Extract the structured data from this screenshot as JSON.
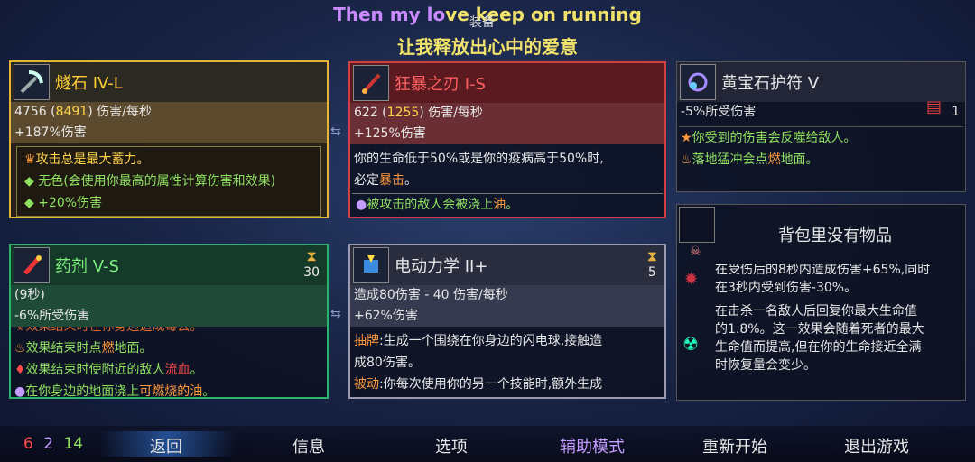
{
  "lyrics": {
    "line1_a": "Then my lo",
    "line1_b": "ve keep on running",
    "line2": "让我释放出心中的爱意",
    "overlay": "装备"
  },
  "cards": {
    "stone": {
      "name": "燧石  IV-L",
      "dps": "4756",
      "dps_max": "8491",
      "dps_unit": "伤害/每秒",
      "bonus": "+187%伤害",
      "desc": [
        "攻击总是最大蓄力。",
        "无色(会使用你最高的属性计算伤害和效果)",
        "+20%伤害"
      ]
    },
    "blade": {
      "name": "狂暴之刃  I-S",
      "dps": "622",
      "dps_max": "1255",
      "dps_unit": "伤害/每秒",
      "bonus": "+125%伤害",
      "desc1": "你的生命低于50%或是你的疫病高于50%时,",
      "desc2a": "必定",
      "desc2b": "暴击",
      "desc2c": "。",
      "desc3a": "被攻击的敌人会被浇上",
      "desc3b": "油",
      "desc3c": "。"
    },
    "amulet": {
      "name": "黄宝石护符  V",
      "stat": "-5%所受伤害",
      "scroll_count": "1",
      "desc1": "你受到的伤害会反噬给敌人。",
      "desc2a": "落地猛冲会点",
      "desc2b": "燃",
      "desc2c": "地面。"
    },
    "bag": {
      "empty": "背包里没有物品",
      "line1": "在受伤后的8秒内造成伤害+65%,同时",
      "line2": "在3秒内受到伤害-30%。",
      "line3": "在击杀一名敌人后回复你最大生命值",
      "line4": "的1.8%。这一效果会随着死者的最大",
      "line5": "生命值而提高,但在你的生命接近全满",
      "line6": "时恢复量会变少。"
    },
    "potion": {
      "name": "药剂  V-S",
      "cooldown": "30",
      "duration": "(9秒)",
      "stat": "-6%所受伤害",
      "desc0": "效果结束时在你身边造成毒云。",
      "desc1a": "效果结束时点",
      "desc1b": "燃",
      "desc1c": "地面。",
      "desc2a": "效果结束时使附近的敌人",
      "desc2b": "流血",
      "desc2c": "。",
      "desc3a": "在你身边的地面浇上",
      "desc3b": "可燃烧的油",
      "desc3c": "。"
    },
    "electro": {
      "name": "电动力学  II+",
      "cooldown": "5",
      "dps": "造成80伤害 - 40 伤害/每秒",
      "bonus": "+62%伤害",
      "desc1_label": "抽牌",
      "desc1": ":生成一个围绕在你身边的闪电球,接触造",
      "desc1b": "成80伤害。",
      "desc2_label": "被动",
      "desc2": ":你每次使用你的另一个技能时,额外生成"
    }
  },
  "scrolls": {
    "red": "6",
    "purple": "2",
    "green": "14"
  },
  "nav": {
    "back": "返回",
    "info": "信息",
    "options": "选项",
    "assist": "辅助模式",
    "restart": "重新开始",
    "quit": "退出游戏"
  },
  "colors": {
    "stone_border": "#e5b535",
    "blade_border": "#d04040",
    "potion_border": "#2ab36a",
    "assist_color": "#c59cff"
  }
}
